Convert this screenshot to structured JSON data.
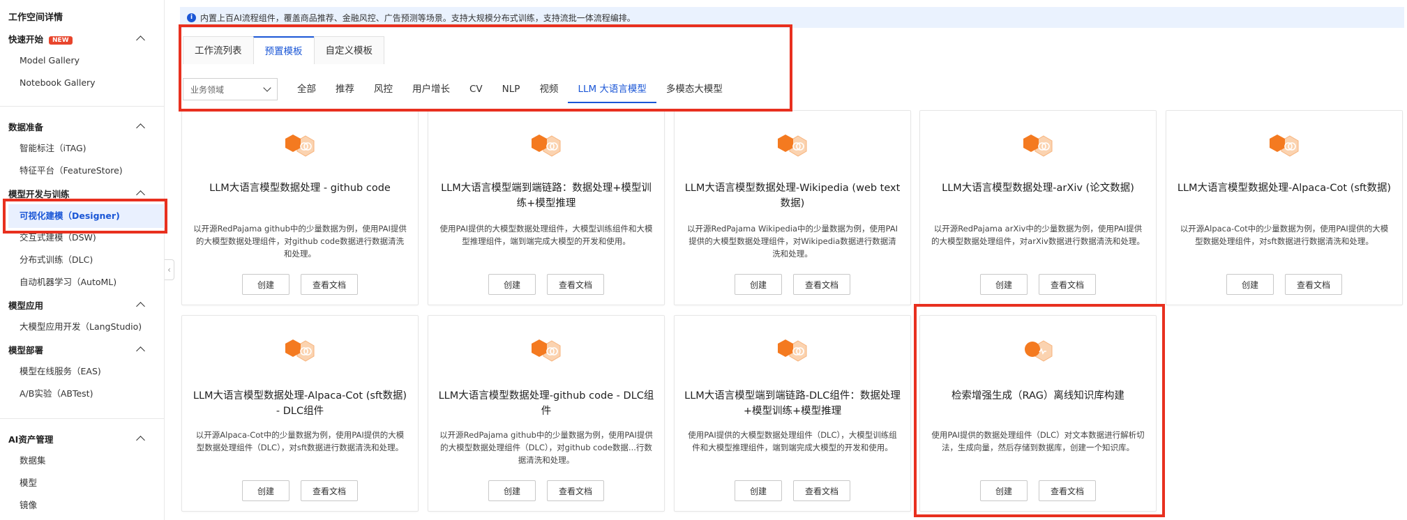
{
  "sidebar": {
    "title": "工作空间详情",
    "groups": [
      {
        "label": "快速开始",
        "badge": "NEW",
        "items": [
          "Model Gallery",
          "Notebook Gallery"
        ]
      },
      {
        "label": "数据准备",
        "items": [
          "智能标注（iTAG)",
          "特征平台（FeatureStore)"
        ]
      },
      {
        "label": "模型开发与训练",
        "items": [
          "可视化建模（Designer)",
          "交互式建模（DSW)",
          "分布式训练（DLC)",
          "自动机器学习（AutoML)"
        ]
      },
      {
        "label": "模型应用",
        "items": [
          "大模型应用开发（LangStudio)"
        ]
      },
      {
        "label": "模型部署",
        "items": [
          "模型在线服务（EAS)",
          "A/B实验（ABTest)"
        ]
      },
      {
        "label": "AI资产管理",
        "items": [
          "数据集",
          "模型",
          "镜像"
        ]
      }
    ],
    "active_item": "可视化建模（Designer)"
  },
  "notice": {
    "text": "内置上百AI流程组件，覆盖商品推荐、金融风控、广告预测等场景。支持大规模分布式训练，支持流批一体流程编排。"
  },
  "tabs": [
    "工作流列表",
    "预置模板",
    "自定义模板"
  ],
  "active_tab": "预置模板",
  "domain_select": {
    "placeholder": "业务领域"
  },
  "categories": [
    "全部",
    "推荐",
    "风控",
    "用户增长",
    "CV",
    "NLP",
    "视频",
    "LLM 大语言模型",
    "多模态大模型"
  ],
  "active_category": "LLM 大语言模型",
  "cards": [
    {
      "title": "LLM大语言模型数据处理 - github code",
      "desc": "以开源RedPajama github中的少量数据为例，使用PAI提供的大模型数据处理组件，对github code数据进行数据清洗和处理。"
    },
    {
      "title": "LLM大语言模型端到端链路：数据处理+模型训练+模型推理",
      "desc": "使用PAI提供的大模型数据处理组件，大模型训练组件和大模型推理组件，端到端完成大模型的开发和使用。"
    },
    {
      "title": "LLM大语言模型数据处理-Wikipedia (web text数据)",
      "desc": "以开源RedPajama Wikipedia中的少量数据为例，使用PAI提供的大模型数据处理组件，对Wikipedia数据进行数据清洗和处理。"
    },
    {
      "title": "LLM大语言模型数据处理-arXiv (论文数据)",
      "desc": "以开源RedPajama arXiv中的少量数据为例，使用PAI提供的大模型数据处理组件，对arXiv数据进行数据清洗和处理。"
    },
    {
      "title": "LLM大语言模型数据处理-Alpaca-Cot (sft数据)",
      "desc": "以开源Alpaca-Cot中的少量数据为例，使用PAI提供的大模型数据处理组件，对sft数据进行数据清洗和处理。"
    },
    {
      "title": "LLM大语言模型数据处理-Alpaca-Cot (sft数据) - DLC组件",
      "desc": "以开源Alpaca-Cot中的少量数据为例，使用PAI提供的大模型数据处理组件（DLC），对sft数据进行数据清洗和处理。"
    },
    {
      "title": "LLM大语言模型数据处理-github code - DLC组件",
      "desc": "以开源RedPajama github中的少量数据为例，使用PAI提供的大模型数据处理组件（DLC），对github code数据...行数据清洗和处理。"
    },
    {
      "title": "LLM大语言模型端到端链路-DLC组件：数据处理+模型训练+模型推理",
      "desc": "使用PAI提供的大模型数据处理组件（DLC），大模型训练组件和大模型推理组件，端到端完成大模型的开发和使用。"
    },
    {
      "title": "检索增强生成（RAG）离线知识库构建",
      "desc": "使用PAI提供的数据处理组件（DLC）对文本数据进行解析切法，生成向量，然后存储到数据库，创建一个知识库。"
    }
  ],
  "card_actions": {
    "create": "创建",
    "docs": "查看文档"
  },
  "colors": {
    "accent": "#1a56d6",
    "highlight_red": "#e8301f",
    "icon_orange": "#f47a20",
    "new_badge": "#e8452c"
  }
}
